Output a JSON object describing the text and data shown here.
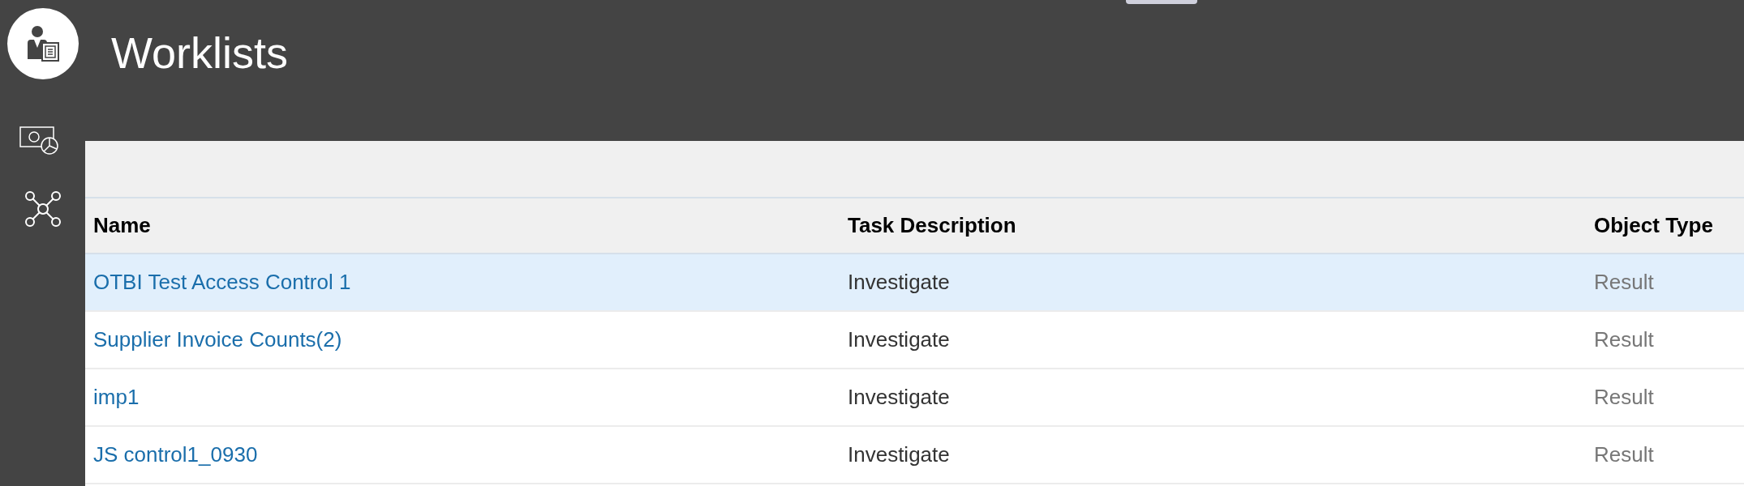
{
  "header": {
    "title": "Worklists"
  },
  "table": {
    "columns": [
      "Name",
      "Task Description",
      "Object Type"
    ],
    "rows": [
      {
        "name": "OTBI Test Access Control 1",
        "task_description": "Investigate",
        "object_type": "Result",
        "selected": true
      },
      {
        "name": "Supplier Invoice Counts(2)",
        "task_description": "Investigate",
        "object_type": "Result",
        "selected": false
      },
      {
        "name": "imp1",
        "task_description": "Investigate",
        "object_type": "Result",
        "selected": false
      },
      {
        "name": "JS control1_0930",
        "task_description": "Investigate",
        "object_type": "Result",
        "selected": false
      }
    ]
  }
}
